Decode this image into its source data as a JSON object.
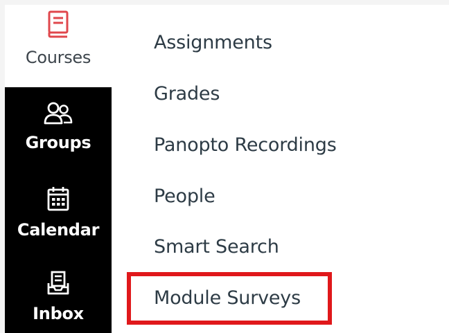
{
  "global_nav": {
    "items": [
      {
        "label": "Courses",
        "icon": "book-icon"
      },
      {
        "label": "Groups",
        "icon": "users-icon"
      },
      {
        "label": "Calendar",
        "icon": "calendar-icon"
      },
      {
        "label": "Inbox",
        "icon": "inbox-icon"
      }
    ]
  },
  "course_menu": {
    "items": [
      {
        "label": "Assignments"
      },
      {
        "label": "Grades"
      },
      {
        "label": "Panopto Recordings"
      },
      {
        "label": "People"
      },
      {
        "label": "Smart Search"
      },
      {
        "label": "Module Surveys",
        "highlighted": true
      }
    ]
  },
  "colors": {
    "courses_icon": "#e0474c",
    "nav_dark_bg": "#000000",
    "link_text": "#2d3b45",
    "highlight_border": "#e0181b"
  }
}
